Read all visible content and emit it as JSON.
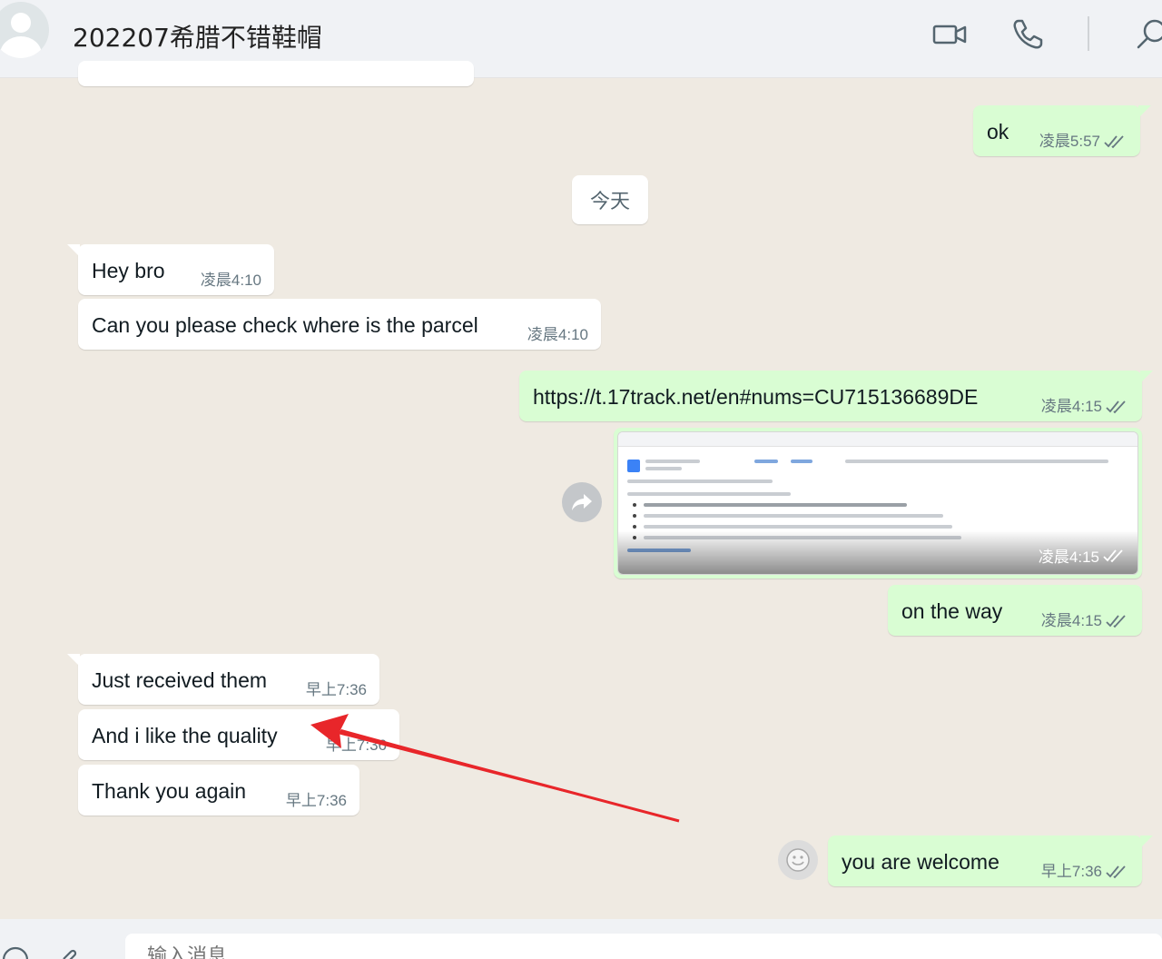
{
  "header": {
    "title": "202207希腊不错鞋帽",
    "icons": [
      "video-call-icon",
      "voice-call-icon",
      "search-icon"
    ]
  },
  "date_divider": "今天",
  "messages": [
    {
      "dir": "out",
      "text": "ok",
      "time": "凌晨5:57",
      "status": "read"
    },
    {
      "dir": "in",
      "text": "Hey bro",
      "time": "凌晨4:10"
    },
    {
      "dir": "in",
      "text": "Can you please check where is the parcel",
      "time": "凌晨4:10"
    },
    {
      "dir": "out",
      "text": "https://t.17track.net/en#nums=CU715136689DE",
      "time": "凌晨4:15",
      "status": "read",
      "is_link": true
    },
    {
      "dir": "out",
      "type": "image",
      "caption_time": "凌晨4:15",
      "status": "read",
      "icon": "tracking-screenshot"
    },
    {
      "dir": "out",
      "text": "on the way",
      "time": "凌晨4:15",
      "status": "read"
    },
    {
      "dir": "in",
      "text": "Just received them",
      "time": "早上7:36"
    },
    {
      "dir": "in",
      "text": "And i like the quality",
      "time": "早上7:36"
    },
    {
      "dir": "in",
      "text": "Thank you again",
      "time": "早上7:36"
    },
    {
      "dir": "out",
      "text": "you are welcome",
      "time": "早上7:36",
      "status": "read"
    }
  ],
  "annotation": {
    "color": "#e8262a",
    "icon": "red-arrow"
  },
  "composer": {
    "placeholder": "输入消息"
  },
  "colors": {
    "outgoing_bubble": "#d9fdd3",
    "incoming_bubble": "#ffffff",
    "chat_background": "#efeae2",
    "link": "#027eb5",
    "read_ticks": "#667781"
  }
}
